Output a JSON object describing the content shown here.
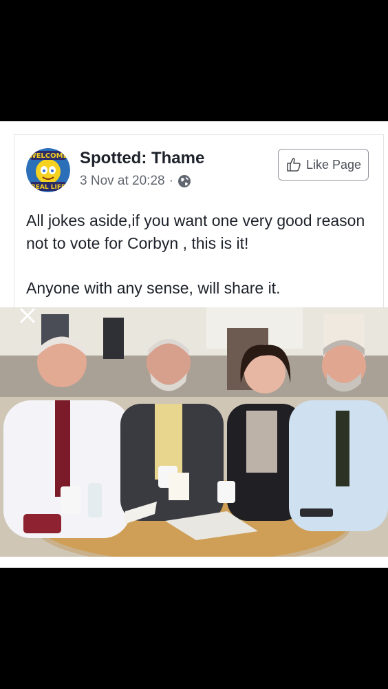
{
  "post": {
    "page_name": "Spotted: Thame",
    "timestamp": "3 Nov at 20:28",
    "separator": "·",
    "audience_icon": "globe-icon",
    "like_page_label": "Like Page",
    "like_icon": "thumbs-up-icon",
    "text_line_1": "All jokes aside,if you want one very good reason not to vote for Corbyn , this is it!",
    "text_line_2": "Anyone with any sense, will share it.",
    "avatar": {
      "top_text": "WELCOME",
      "bottom_text": "REAL LIFE"
    },
    "photo": {
      "close_icon": "close-icon"
    }
  },
  "colors": {
    "background": "#000000",
    "card": "#ffffff",
    "text_primary": "#1d2129",
    "text_secondary": "#616770",
    "button_border": "#90949c"
  }
}
